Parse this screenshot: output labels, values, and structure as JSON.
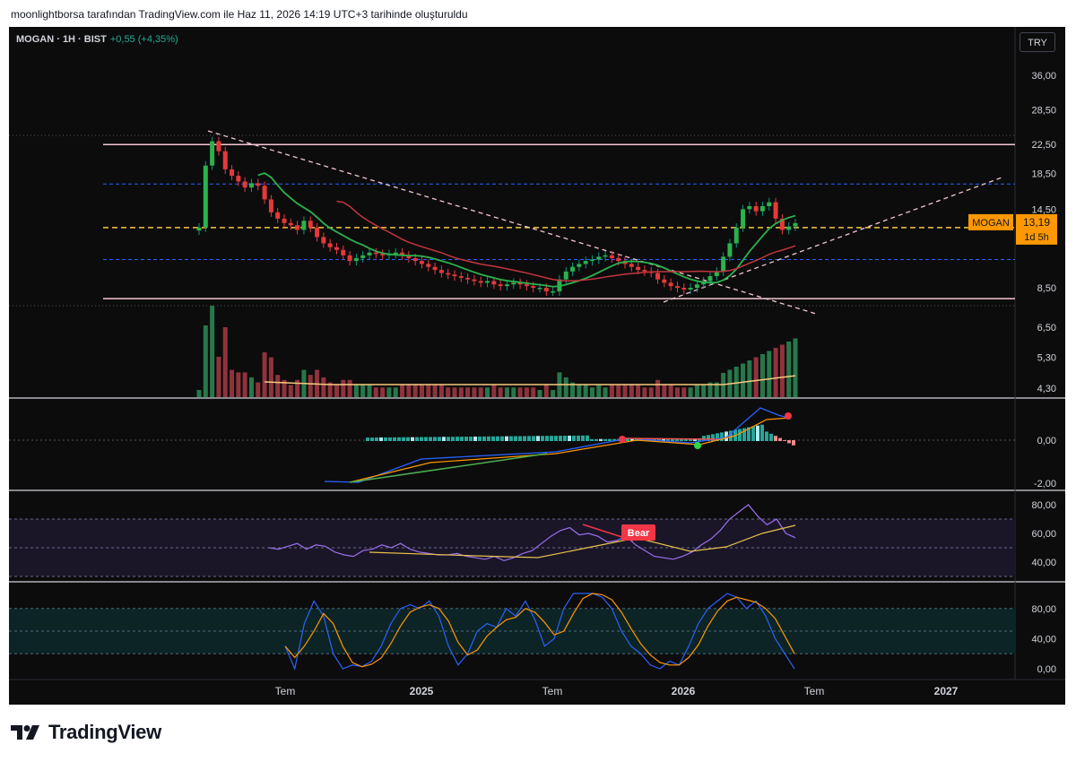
{
  "header": {
    "text": "moonlightborsa tarafından TradingView.com ile Haz 11, 2026 14:19 UTC+3 tarihinde oluşturuldu"
  },
  "legend": {
    "symbol": "MOGAN · 1H · BIST",
    "change": "+0,55 (+4,35%)"
  },
  "currency": "TRY",
  "footer": {
    "brand": "TradingView"
  },
  "colors": {
    "up": "#089981",
    "down": "#f23645",
    "green_ma": "#2bb24c",
    "red_ma": "#c2353f",
    "blue": "#2962ff",
    "orange": "#ff9800",
    "yellow": "#f5c842",
    "purple": "#9c6ff0"
  },
  "chart_data": [
    {
      "type": "line",
      "name": "price",
      "price_axis": [
        {
          "label": "36,00",
          "value": 36
        },
        {
          "label": "28,50",
          "value": 28.5
        },
        {
          "label": "22,50",
          "value": 22.5
        },
        {
          "label": "18,50",
          "value": 18.5
        },
        {
          "label": "14,50",
          "value": 14.5
        },
        {
          "label": "8,50",
          "value": 8.5
        },
        {
          "label": "6,50",
          "value": 6.5
        },
        {
          "label": "5,30",
          "value": 5.3
        },
        {
          "label": "4,30",
          "value": 4.3
        }
      ],
      "scale": "log",
      "time_axis": [
        "Tem",
        "2025",
        "Tem",
        "2026",
        "Tem",
        "2027"
      ],
      "last_price_tag": {
        "symbol": "MOGAN",
        "price": "13,19",
        "countdown": "1d 5h"
      },
      "levels": {
        "top_resistance": 22.5,
        "blue_upper": 17.2,
        "yellow": 12.8,
        "blue_lower": 10.3,
        "bottom_support": 7.9
      },
      "closes": [
        12.8,
        19.5,
        23,
        21.5,
        19,
        18.2,
        17.5,
        16.8,
        17.3,
        17,
        15.5,
        14.2,
        13.6,
        13.2,
        13,
        12.6,
        13.4,
        12.8,
        12,
        11.5,
        11.2,
        11,
        10.6,
        10.2,
        10.4,
        10.6,
        10.8,
        10.7,
        10.6,
        10.7,
        10.8,
        10.6,
        10.4,
        10.2,
        10,
        9.8,
        9.6,
        9.4,
        9.3,
        9.2,
        9.1,
        9.0,
        8.9,
        8.8,
        8.9,
        8.7,
        8.6,
        8.7,
        8.8,
        8.7,
        8.6,
        8.5,
        8.5,
        8.3,
        8.3,
        9.0,
        9.5,
        9.8,
        10.0,
        10.2,
        10.3,
        10.5,
        10.6,
        10.4,
        10.2,
        10.0,
        9.8,
        9.6,
        9.5,
        9.4,
        9.0,
        8.8,
        8.6,
        8.5,
        8.4,
        8.5,
        8.7,
        8.9,
        9.2,
        9.5,
        10.5,
        11.5,
        12.8,
        14.5,
        14.8,
        14.3,
        14.8,
        15.2,
        13.6,
        12.6,
        12.9,
        13.19
      ]
    },
    {
      "type": "bar",
      "name": "volume"
    },
    {
      "type": "line",
      "name": "macd",
      "y_axis": [
        {
          "label": "0,00",
          "value": 0
        },
        {
          "label": "-2,00",
          "value": -2
        }
      ]
    },
    {
      "type": "line",
      "name": "rsi",
      "y_axis": [
        {
          "label": "80,00",
          "value": 80
        },
        {
          "label": "60,00",
          "value": 60
        },
        {
          "label": "40,00",
          "value": 40
        }
      ],
      "annotation": "Bear"
    },
    {
      "type": "line",
      "name": "stochastic",
      "y_axis": [
        {
          "label": "80,00",
          "value": 80
        },
        {
          "label": "40,00",
          "value": 40
        },
        {
          "label": "0,00",
          "value": 0
        }
      ]
    }
  ]
}
